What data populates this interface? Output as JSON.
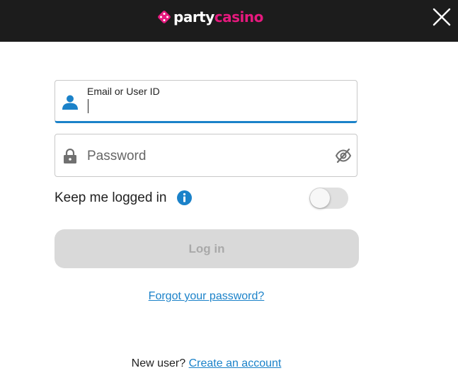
{
  "brand": {
    "logo_part1": "party",
    "logo_part2": "casino",
    "accent": "#e6197e"
  },
  "header": {
    "close_icon": "close-icon",
    "background": "#1c1c1c"
  },
  "email_field": {
    "label": "Email or User ID",
    "value": "",
    "icon": "user-icon",
    "focus_color": "#1b82c9"
  },
  "password_field": {
    "placeholder": "Password",
    "value": "",
    "icon": "lock-icon",
    "toggle_icon": "eye-off-icon"
  },
  "keep_logged_in": {
    "label": "Keep me logged in",
    "info_icon": "info-icon",
    "enabled": false
  },
  "login_button": {
    "label": "Log in",
    "disabled": true
  },
  "forgot_password": {
    "label": "Forgot your password?"
  },
  "signup": {
    "prompt": "New user?",
    "link": "Create an account"
  }
}
